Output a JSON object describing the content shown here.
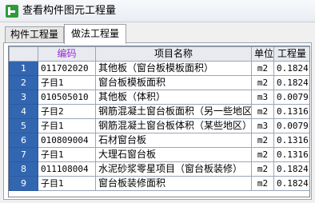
{
  "window": {
    "title": "查看构件图元工程量",
    "icon": "app-grid-icon"
  },
  "tabs": [
    {
      "label": "构件工程量",
      "active": false
    },
    {
      "label": "做法工程量",
      "active": true
    }
  ],
  "table": {
    "columns": [
      "",
      "编码",
      "项目名称",
      "单位",
      "工程量"
    ],
    "rows": [
      {
        "num": "1",
        "code": "011702020",
        "name": "其他板（窗台板模板面积）",
        "unit": "m2",
        "qty": "0.1824"
      },
      {
        "num": "2",
        "code": "子目1",
        "name": "窗台板模板面积",
        "unit": "m2",
        "qty": "0.1824"
      },
      {
        "num": "3",
        "code": "010505010",
        "name": "其他板（体积）",
        "unit": "m3",
        "qty": "0.0079"
      },
      {
        "num": "4",
        "code": "子目2",
        "name": "钢筋混凝土窗台板面积（另一些地区）",
        "unit": "m2",
        "qty": "0.1316"
      },
      {
        "num": "5",
        "code": "子目1",
        "name": "钢筋混凝土窗台板体积（某些地区）",
        "unit": "m3",
        "qty": "0.0079"
      },
      {
        "num": "6",
        "code": "010809004",
        "name": "石材窗台板",
        "unit": "m2",
        "qty": "0.1316"
      },
      {
        "num": "7",
        "code": "子目1",
        "name": "大理石窗台板",
        "unit": "m2",
        "qty": "0.1316"
      },
      {
        "num": "8",
        "code": "011108004",
        "name": "水泥砂浆零星项目（窗台板装修）",
        "unit": "m2",
        "qty": "0.1824"
      },
      {
        "num": "9",
        "code": "子目1",
        "name": "窗台板装修面积",
        "unit": "m2",
        "qty": "0.1824"
      }
    ]
  },
  "colors": {
    "row_header_bg": "#3366b0",
    "code_header_text": "#9b2ad6",
    "grid_line": "#9aa6b8"
  }
}
